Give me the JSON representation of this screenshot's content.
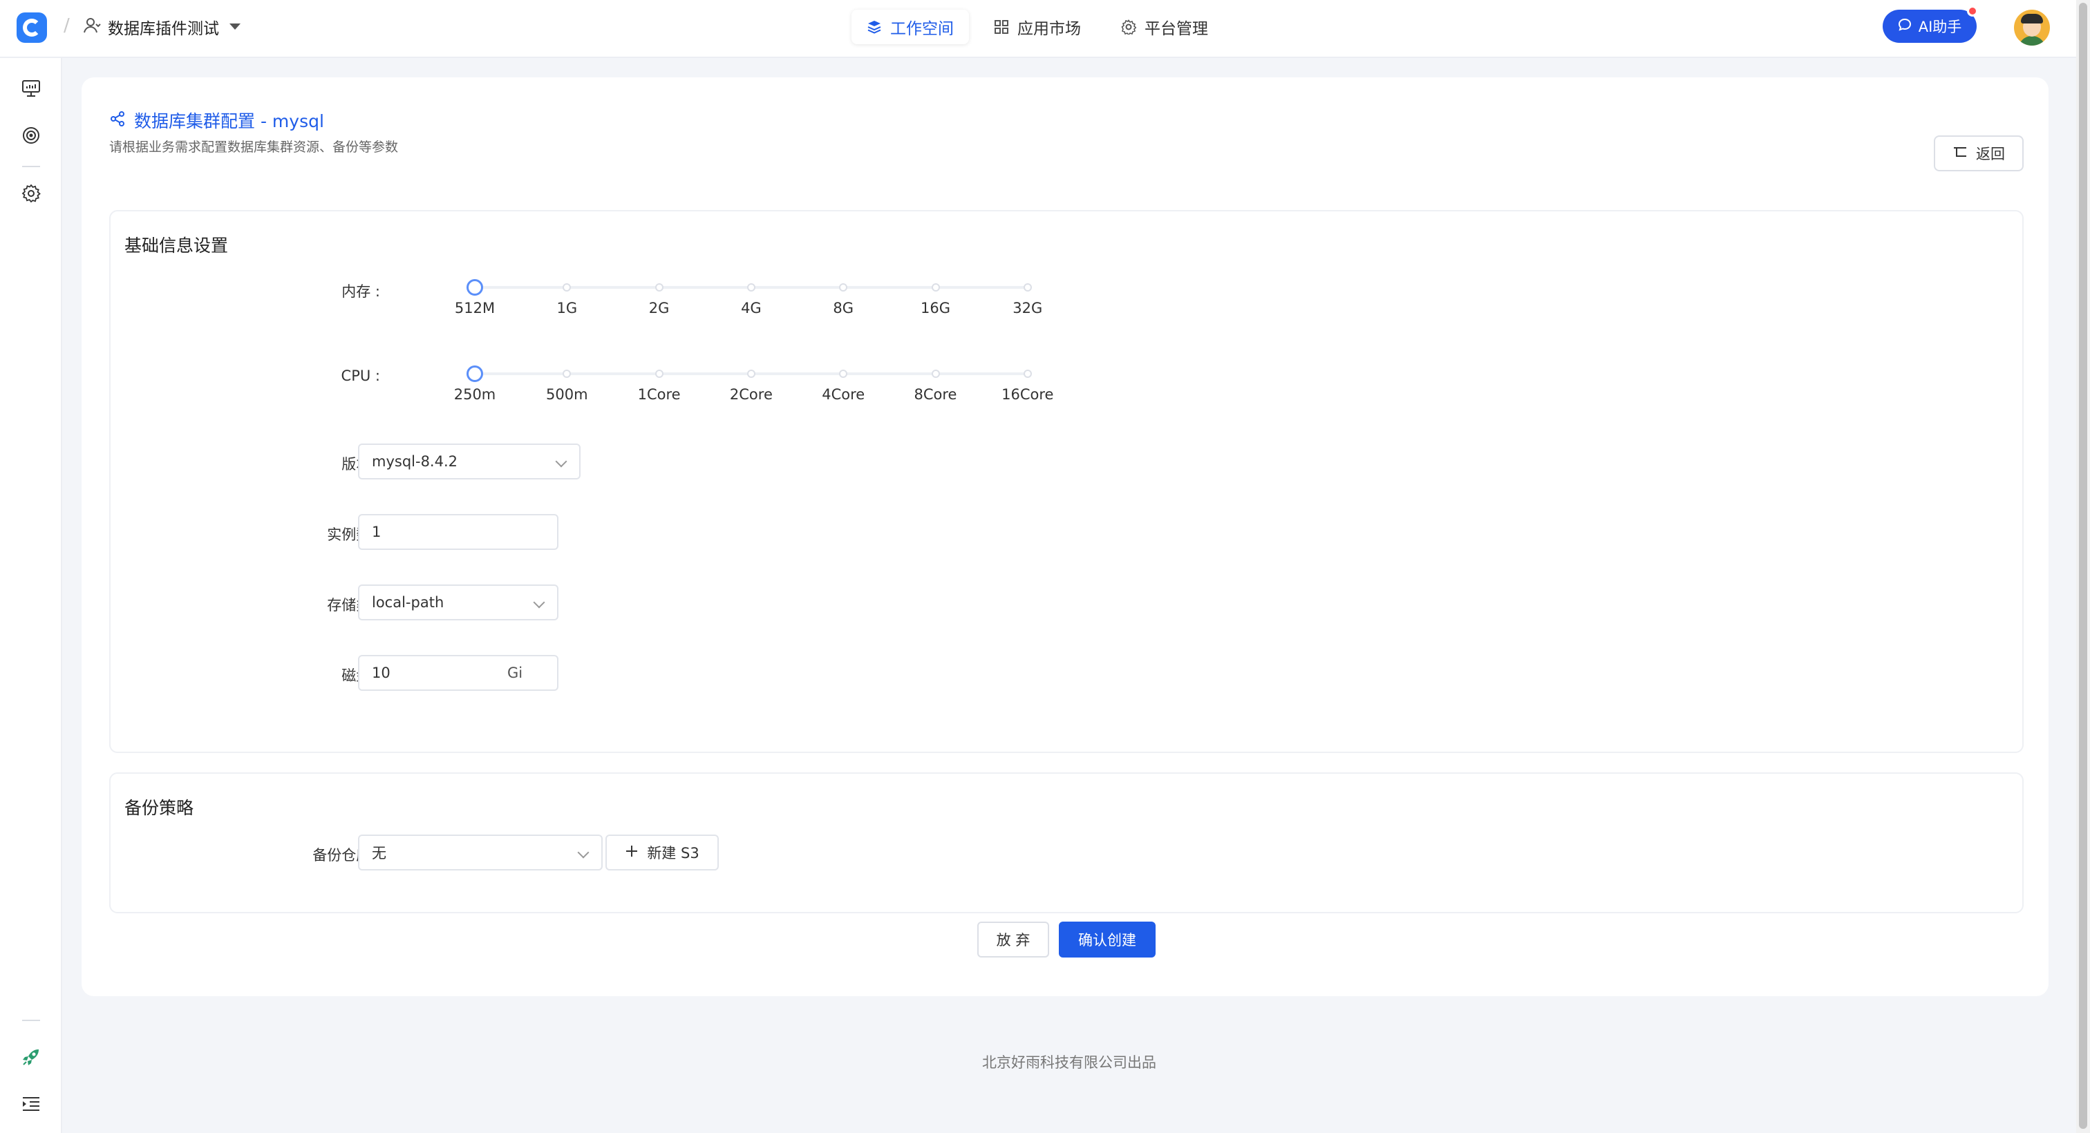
{
  "header": {
    "separator": "/",
    "workspace_name": "数据库插件测试",
    "nav_tabs": [
      {
        "label": "工作空间",
        "active": true,
        "icon": "layers-icon"
      },
      {
        "label": "应用市场",
        "active": false,
        "icon": "grid-icon"
      },
      {
        "label": "平台管理",
        "active": false,
        "icon": "gear-icon"
      }
    ],
    "ai_button_label": "AI助手"
  },
  "sidebar": {
    "icons": [
      "monitor-icon",
      "target-icon",
      "settings-icon",
      "rocket-icon",
      "menu-indent-icon"
    ]
  },
  "page": {
    "title": "数据库集群配置 - mysql",
    "subtitle": "请根据业务需求配置数据库集群资源、备份等参数",
    "back_label": "返回"
  },
  "basic_section": {
    "title": "基础信息设置",
    "memory": {
      "label": "内存 :",
      "options": [
        "512M",
        "1G",
        "2G",
        "4G",
        "8G",
        "16G",
        "32G"
      ],
      "selected_index": 0
    },
    "cpu": {
      "label": "CPU :",
      "options": [
        "250m",
        "500m",
        "1Core",
        "2Core",
        "4Core",
        "8Core",
        "16Core"
      ],
      "selected_index": 0
    },
    "version": {
      "label": "版本 :",
      "value": "mysql-8.4.2"
    },
    "instances": {
      "label": "实例数 :",
      "value": "1"
    },
    "storage_class": {
      "label": "存储类 :",
      "value": "local-path"
    },
    "disk": {
      "label": "磁盘 :",
      "value": "10",
      "unit": "Gi"
    }
  },
  "backup_section": {
    "title": "备份策略",
    "repo": {
      "label": "备份仓库 :",
      "value": "无"
    },
    "new_s3_label": "新建 S3"
  },
  "actions": {
    "cancel_label": "放 弃",
    "confirm_label": "确认创建"
  },
  "footer": {
    "copyright": "北京好雨科技有限公司出品"
  },
  "colors": {
    "primary": "#1f5ce8",
    "slider_knob": "#5b8ff9",
    "background": "#f3f5f9"
  }
}
